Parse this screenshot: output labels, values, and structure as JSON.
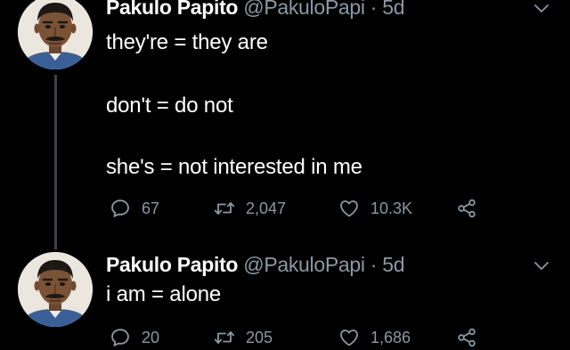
{
  "colors": {
    "background": "#000000",
    "text": "#ffffff",
    "secondary_text": "#8b98a5",
    "thread_line": "#3d4449"
  },
  "tweets": [
    {
      "author_name": "Pakulo Papito",
      "handle": "@PakuloPapi",
      "separator": "·",
      "time": "5d",
      "lines": [
        "they're = they are",
        "don't = do not",
        "she's = not interested in me"
      ],
      "stats": {
        "replies": "67",
        "retweets": "2,047",
        "likes": "10.3K"
      },
      "icons": [
        "reply-icon",
        "retweet-icon",
        "like-icon",
        "share-icon",
        "chevron-down-icon"
      ]
    },
    {
      "author_name": "Pakulo Papito",
      "handle": "@PakuloPapi",
      "separator": "·",
      "time": "5d",
      "lines": [
        "i am = alone"
      ],
      "stats": {
        "replies": "20",
        "retweets": "205",
        "likes": "1,686"
      },
      "icons": [
        "reply-icon",
        "retweet-icon",
        "like-icon",
        "share-icon",
        "chevron-down-icon"
      ]
    }
  ]
}
